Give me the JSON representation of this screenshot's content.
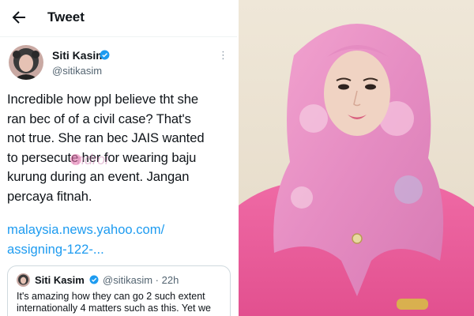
{
  "header": {
    "title": "Tweet",
    "back_icon": "arrow-left-icon"
  },
  "tweet": {
    "author": "Siti Kasim",
    "handle": "@sitikasim",
    "verified_color": "#1d9bf0",
    "body_lines": [
      "Incredible how ppl believe tht she",
      "ran bec of of a civil case? That's",
      "not true. She ran bec JAIS wanted",
      "to persecute her for wearing baju",
      "kurung during an event. Jangan",
      "percaya fitnah."
    ],
    "link_lines": [
      "malaysia.news.yahoo.com/",
      "assigning-122-..."
    ],
    "more_icon": "more-dots-icon"
  },
  "watermark": "mdroi",
  "quote": {
    "author": "Siti Kasim",
    "handle": "@sitikasim",
    "separator": "·",
    "time": "22h",
    "text": "It's amazing how they can go 2 such extent internationally 4 matters such as this. Yet we"
  },
  "colors": {
    "link": "#1d9bf0",
    "text": "#0f1419",
    "muted": "#536471",
    "scarf_pink": "#e48ac0",
    "shirt_pink": "#ec5a98"
  }
}
